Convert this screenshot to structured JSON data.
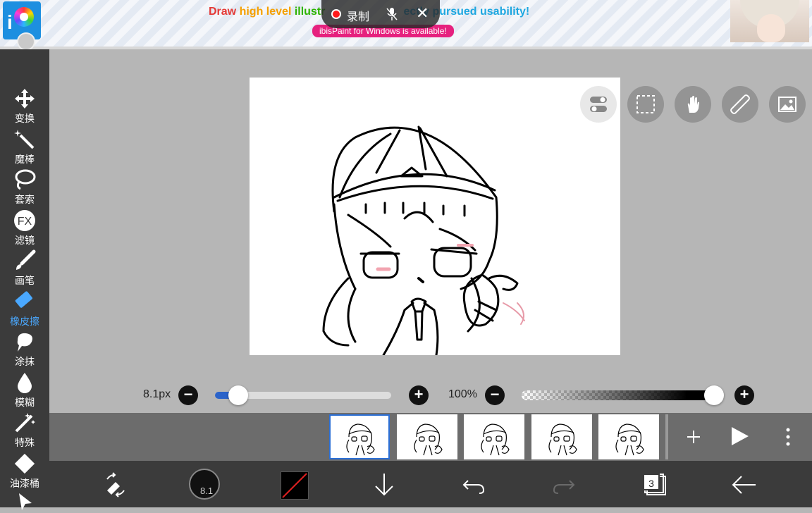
{
  "banner": {
    "words": [
      "Draw",
      "high level",
      "illustr",
      "",
      "perfectly pursued usability!"
    ],
    "headline_part1": "Draw ",
    "headline_part2": "high ",
    "headline_part3": "level ",
    "headline_part4": "illustr",
    "headline_part5": "                         ectly pursued usability!",
    "pill": "ibisPaint for Windows is available!"
  },
  "recording": {
    "label": "录制",
    "close": "✕"
  },
  "tools": [
    {
      "id": "transform",
      "label": "变换"
    },
    {
      "id": "magic-wand",
      "label": "魔棒"
    },
    {
      "id": "lasso",
      "label": "套索"
    },
    {
      "id": "filter",
      "label": "滤镜",
      "icon_text": "FX"
    },
    {
      "id": "brush",
      "label": "画笔"
    },
    {
      "id": "eraser",
      "label": "橡皮擦",
      "active": true
    },
    {
      "id": "smudge",
      "label": "涂抹"
    },
    {
      "id": "blur",
      "label": "模糊"
    },
    {
      "id": "special",
      "label": "特殊"
    },
    {
      "id": "fill",
      "label": "油漆桶"
    }
  ],
  "brush_size": {
    "label": "8.1px",
    "value": 8.1,
    "fraction": 0.13
  },
  "opacity": {
    "label": "100%",
    "value": 100
  },
  "frames": {
    "count": 5,
    "selected": 1
  },
  "bottom": {
    "brush_size_text": "8.1",
    "layer_count": "3"
  },
  "colors": {
    "accent": "#2b63c9",
    "active_tool": "#4aa8ff",
    "toolbar": "#3b3b3b",
    "record": "#ff1a1a"
  }
}
